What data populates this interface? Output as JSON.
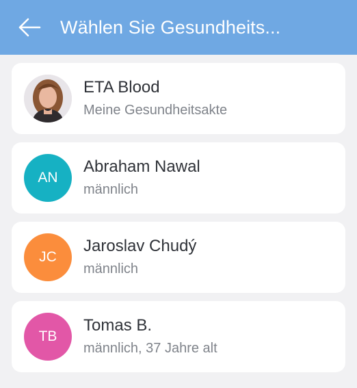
{
  "app_bar": {
    "title": "Wählen Sie Gesundheits...",
    "background": "#6fa8e3",
    "back_icon": "arrow-left-icon"
  },
  "records": [
    {
      "name": "ETA Blood",
      "subtitle": "Meine Gesundheitsakte",
      "avatar": {
        "type": "photo"
      }
    },
    {
      "name": "Abraham Nawal",
      "subtitle": "männlich",
      "avatar": {
        "type": "initials",
        "initials": "AN",
        "color": "#16b1c3"
      }
    },
    {
      "name": "Jaroslav Chudý",
      "subtitle": "männlich",
      "avatar": {
        "type": "initials",
        "initials": "JC",
        "color": "#fb8d3c"
      }
    },
    {
      "name": "Tomas B.",
      "subtitle": "männlich, 37 Jahre alt",
      "avatar": {
        "type": "initials",
        "initials": "TB",
        "color": "#e257a7"
      }
    }
  ]
}
